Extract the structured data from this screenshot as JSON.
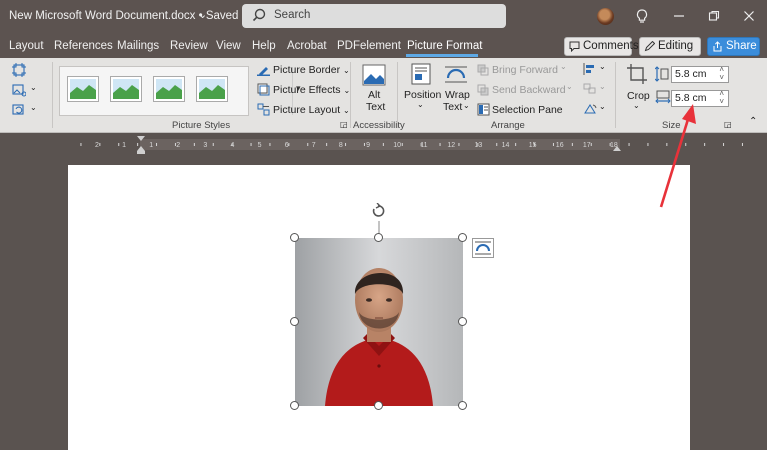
{
  "titlebar": {
    "document_title": "New Microsoft Word Document.docx • Saved",
    "search_placeholder": "Search"
  },
  "menu": {
    "items": [
      "Layout",
      "References",
      "Mailings",
      "Review",
      "View",
      "Help",
      "Acrobat",
      "PDFelement",
      "Picture Format"
    ],
    "active": "Picture Format",
    "comments_label": "Comments",
    "editing_label": "Editing",
    "share_label": "Share"
  },
  "ribbon": {
    "picture_styles": {
      "group_label": "Picture Styles",
      "picture_border": "Picture Border",
      "picture_effects": "Picture Effects",
      "picture_layout": "Picture Layout"
    },
    "accessibility": {
      "group_label": "Accessibility",
      "alt_text_line1": "Alt",
      "alt_text_line2": "Text"
    },
    "arrange": {
      "group_label": "Arrange",
      "position": "Position",
      "wrap_line1": "Wrap",
      "wrap_line2": "Text",
      "bring_forward": "Bring Forward",
      "send_backward": "Send Backward",
      "selection_pane": "Selection Pane"
    },
    "size": {
      "group_label": "Size",
      "crop": "Crop",
      "height": "5.8 cm",
      "width": "5.8 cm"
    }
  },
  "ruler": {
    "numbers": [
      "2",
      "1",
      "1",
      "2",
      "3",
      "4",
      "5",
      "6",
      "7",
      "8",
      "9",
      "10",
      "11",
      "12",
      "13",
      "14",
      "15",
      "16",
      "17",
      "18"
    ]
  },
  "colors": {
    "accent_blue": "#3b8ddb",
    "annotation_arrow": "#e8323a",
    "shirt_red": "#b31b1b"
  }
}
